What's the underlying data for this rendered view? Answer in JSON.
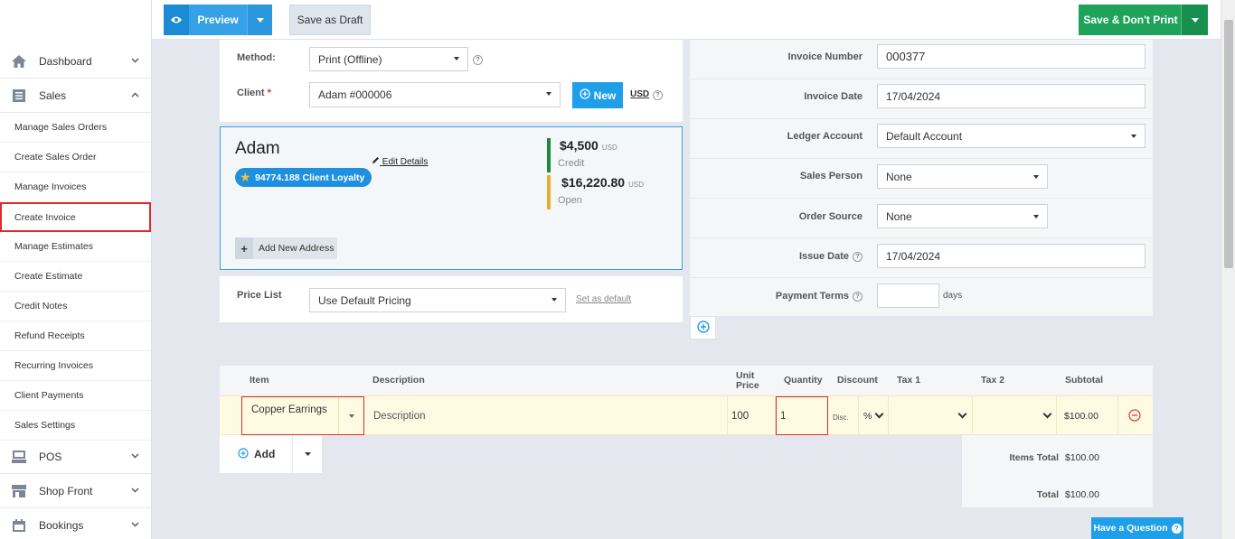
{
  "sidebar": {
    "dashboard": "Dashboard",
    "sales": "Sales",
    "items": [
      "Manage Sales Orders",
      "Create Sales Order",
      "Manage Invoices",
      "Create Invoice",
      "Manage Estimates",
      "Create Estimate",
      "Credit Notes",
      "Refund Receipts",
      "Recurring Invoices",
      "Client Payments",
      "Sales Settings"
    ],
    "pos": "POS",
    "shop_front": "Shop Front",
    "bookings": "Bookings"
  },
  "toolbar": {
    "preview": "Preview",
    "save_draft": "Save as Draft",
    "save_dont_print": "Save & Don't Print"
  },
  "form": {
    "method_label": "Method:",
    "method_value": "Print (Offline)",
    "client_label": "Client",
    "client_required": "*",
    "client_value": "Adam #000006",
    "new_button": "New",
    "currency": "USD",
    "help": "?",
    "price_list_label": "Price List",
    "price_list_value": "Use Default Pricing",
    "set_default": "Set as default"
  },
  "client_card": {
    "name": "Adam",
    "edit_details": "Edit Details",
    "loyalty": "94774.188 Client Loyalty",
    "credit_amount": "$4,500",
    "credit_currency": "USD",
    "credit_label": "Credit",
    "open_amount": "$16,220.80",
    "open_currency": "USD",
    "open_label": "Open",
    "add_address": "Add New Address"
  },
  "invoice_meta": {
    "invoice_number_label": "Invoice Number",
    "invoice_number": "000377",
    "invoice_date_label": "Invoice Date",
    "invoice_date": "17/04/2024",
    "ledger_label": "Ledger Account",
    "ledger_value": "Default Account",
    "sales_person_label": "Sales Person",
    "sales_person_value": "None",
    "order_source_label": "Order Source",
    "order_source_value": "None",
    "issue_date_label": "Issue Date",
    "issue_date": "17/04/2024",
    "payment_terms_label": "Payment Terms",
    "payment_terms_value": "",
    "days": "days"
  },
  "table": {
    "headers": {
      "item": "Item",
      "description": "Description",
      "unit_price_1": "Unit",
      "unit_price_2": "Price",
      "quantity": "Quantity",
      "discount": "Discount",
      "tax1": "Tax 1",
      "tax2": "Tax 2",
      "subtotal": "Subtotal"
    },
    "row": {
      "item": "Copper Earrings",
      "description_placeholder": "Description",
      "unit_price": "100",
      "quantity": "1",
      "disc_label": "Disc.",
      "disc_type": "%",
      "subtotal": "$100.00"
    },
    "add": "Add",
    "items_total_label": "Items Total",
    "items_total": "$100.00",
    "total_label": "Total",
    "total": "$100.00"
  },
  "help_button": "Have a Question"
}
